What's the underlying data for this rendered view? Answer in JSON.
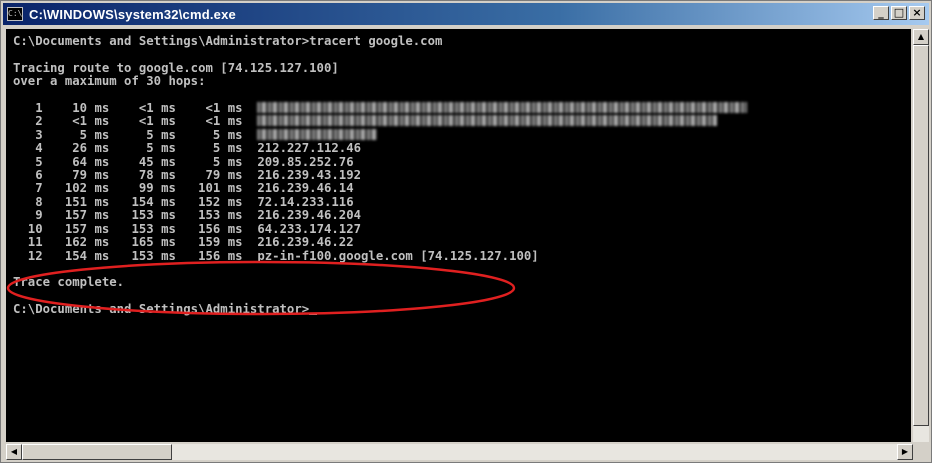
{
  "window": {
    "title": "C:\\WINDOWS\\system32\\cmd.exe",
    "icon_text": "C:\\",
    "buttons": {
      "minimize": "_",
      "maximize": "□",
      "close": "×"
    }
  },
  "console": {
    "command_line": "C:\\Documents and Settings\\Administrator>tracert google.com",
    "trace_header_1": "Tracing route to google.com [74.125.127.100]",
    "trace_header_2": "over a maximum of 30 hops:",
    "hops": [
      {
        "num": "1",
        "t1": "10 ms",
        "t2": "<1 ms",
        "t3": "<1 ms",
        "host": ""
      },
      {
        "num": "2",
        "t1": "<1 ms",
        "t2": "<1 ms",
        "t3": "<1 ms",
        "host": ""
      },
      {
        "num": "3",
        "t1": "5 ms",
        "t2": "5 ms",
        "t3": "5 ms",
        "host": ""
      },
      {
        "num": "4",
        "t1": "26 ms",
        "t2": "5 ms",
        "t3": "5 ms",
        "host": "212.227.112.46"
      },
      {
        "num": "5",
        "t1": "64 ms",
        "t2": "45 ms",
        "t3": "5 ms",
        "host": "209.85.252.76"
      },
      {
        "num": "6",
        "t1": "79 ms",
        "t2": "78 ms",
        "t3": "79 ms",
        "host": "216.239.43.192"
      },
      {
        "num": "7",
        "t1": "102 ms",
        "t2": "99 ms",
        "t3": "101 ms",
        "host": "216.239.46.14"
      },
      {
        "num": "8",
        "t1": "151 ms",
        "t2": "154 ms",
        "t3": "152 ms",
        "host": "72.14.233.116"
      },
      {
        "num": "9",
        "t1": "157 ms",
        "t2": "153 ms",
        "t3": "153 ms",
        "host": "216.239.46.204"
      },
      {
        "num": "10",
        "t1": "157 ms",
        "t2": "153 ms",
        "t3": "156 ms",
        "host": "64.233.174.127"
      },
      {
        "num": "11",
        "t1": "162 ms",
        "t2": "165 ms",
        "t3": "159 ms",
        "host": "216.239.46.22"
      },
      {
        "num": "12",
        "t1": "154 ms",
        "t2": "153 ms",
        "t3": "156 ms",
        "host": "pz-in-f100.google.com [74.125.127.100]"
      }
    ],
    "trace_complete": "Trace complete.",
    "prompt": "C:\\Documents and Settings\\Administrator>"
  },
  "annotation": {
    "color": "#e02020",
    "highlighted_hops": [
      "9",
      "10",
      "11"
    ]
  },
  "scrollbars": {
    "up": "▲",
    "down": "▼",
    "left": "◀",
    "right": "▶"
  }
}
